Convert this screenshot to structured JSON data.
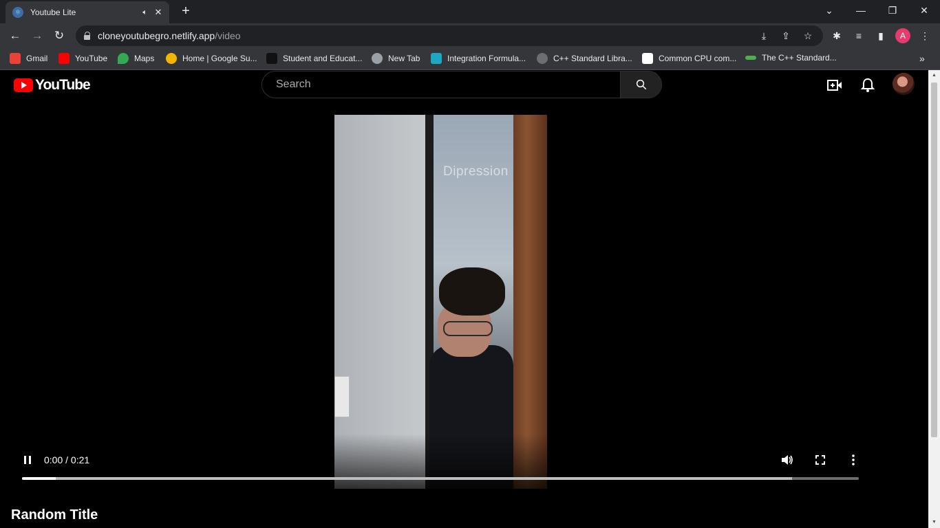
{
  "browser": {
    "tab": {
      "title": "Youtube Lite"
    },
    "url": {
      "host": "cloneyoutubegro.netlify.app",
      "path": "/video"
    },
    "profile_initial": "A",
    "bookmarks": [
      {
        "label": "Gmail",
        "icon": "gmail-icon",
        "color": "#ea4335"
      },
      {
        "label": "YouTube",
        "icon": "youtube-icon",
        "color": "#ff0000"
      },
      {
        "label": "Maps",
        "icon": "maps-icon",
        "color": "#34a853"
      },
      {
        "label": "Home | Google Su...",
        "icon": "google-suite-icon",
        "color": "#f4b400"
      },
      {
        "label": "Student and Educat...",
        "icon": "student-icon",
        "color": "#111111"
      },
      {
        "label": "New Tab",
        "icon": "globe-icon",
        "color": "#9aa0a6"
      },
      {
        "label": "Integration Formula...",
        "icon": "formula-icon",
        "color": "#1ea7c5"
      },
      {
        "label": "C++ Standard Libra...",
        "icon": "cpp-library-icon",
        "color": "#9aa0a6"
      },
      {
        "label": "Common CPU com...",
        "icon": "cpu-icon",
        "color": "#ffffff"
      },
      {
        "label": "The C++ Standard...",
        "icon": "cpp-standard-icon",
        "color": "#4caf50"
      }
    ]
  },
  "header": {
    "logo_text": "YouTube",
    "search_placeholder": "Search"
  },
  "video": {
    "overlay_text": "Dipression",
    "time": "0:00 / 0:21",
    "progress_played": 0.0,
    "progress_buffered": 0.04,
    "progress_loaded_end": 0.92
  },
  "main": {
    "title": "Random Title"
  },
  "colors": {
    "accent": "#ff0000",
    "page_bg": "#000000"
  }
}
